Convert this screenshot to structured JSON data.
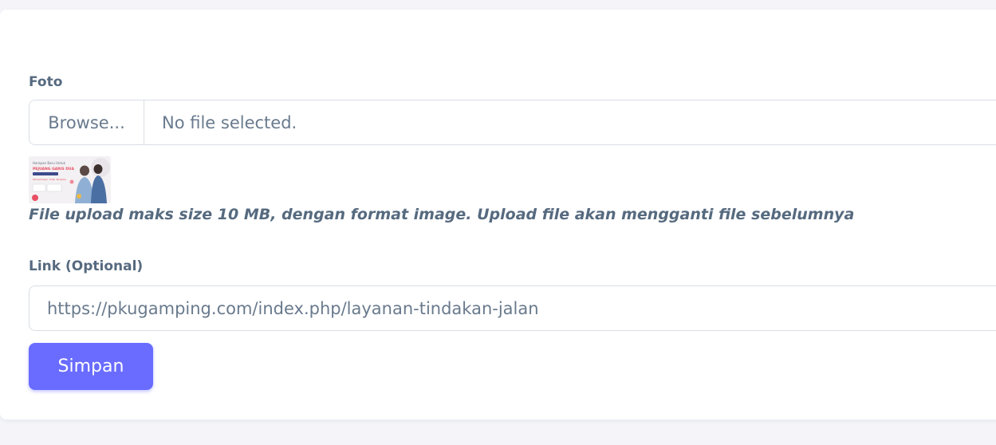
{
  "form": {
    "photo_label": "Foto",
    "file_input": {
      "browse_label": "Browse...",
      "status_text": "No file selected."
    },
    "preview": {
      "heading_small": "Harapan Baru Untuk",
      "heading_big": "PEJUANG GARIS DUA",
      "subtitle": "Pemeriksaan Tidak Terbatas"
    },
    "hint": "File upload maks size 10 MB, dengan format image. Upload file akan mengganti file sebelumnya",
    "link_label": "Link (Optional)",
    "link_value": "https://pkugamping.com/index.php/layanan-tindakan-jalan",
    "save_label": "Simpan"
  },
  "colors": {
    "primary": "#696cff",
    "text": "#566a7f",
    "border": "#d9dee3",
    "background": "#f5f5f9"
  }
}
